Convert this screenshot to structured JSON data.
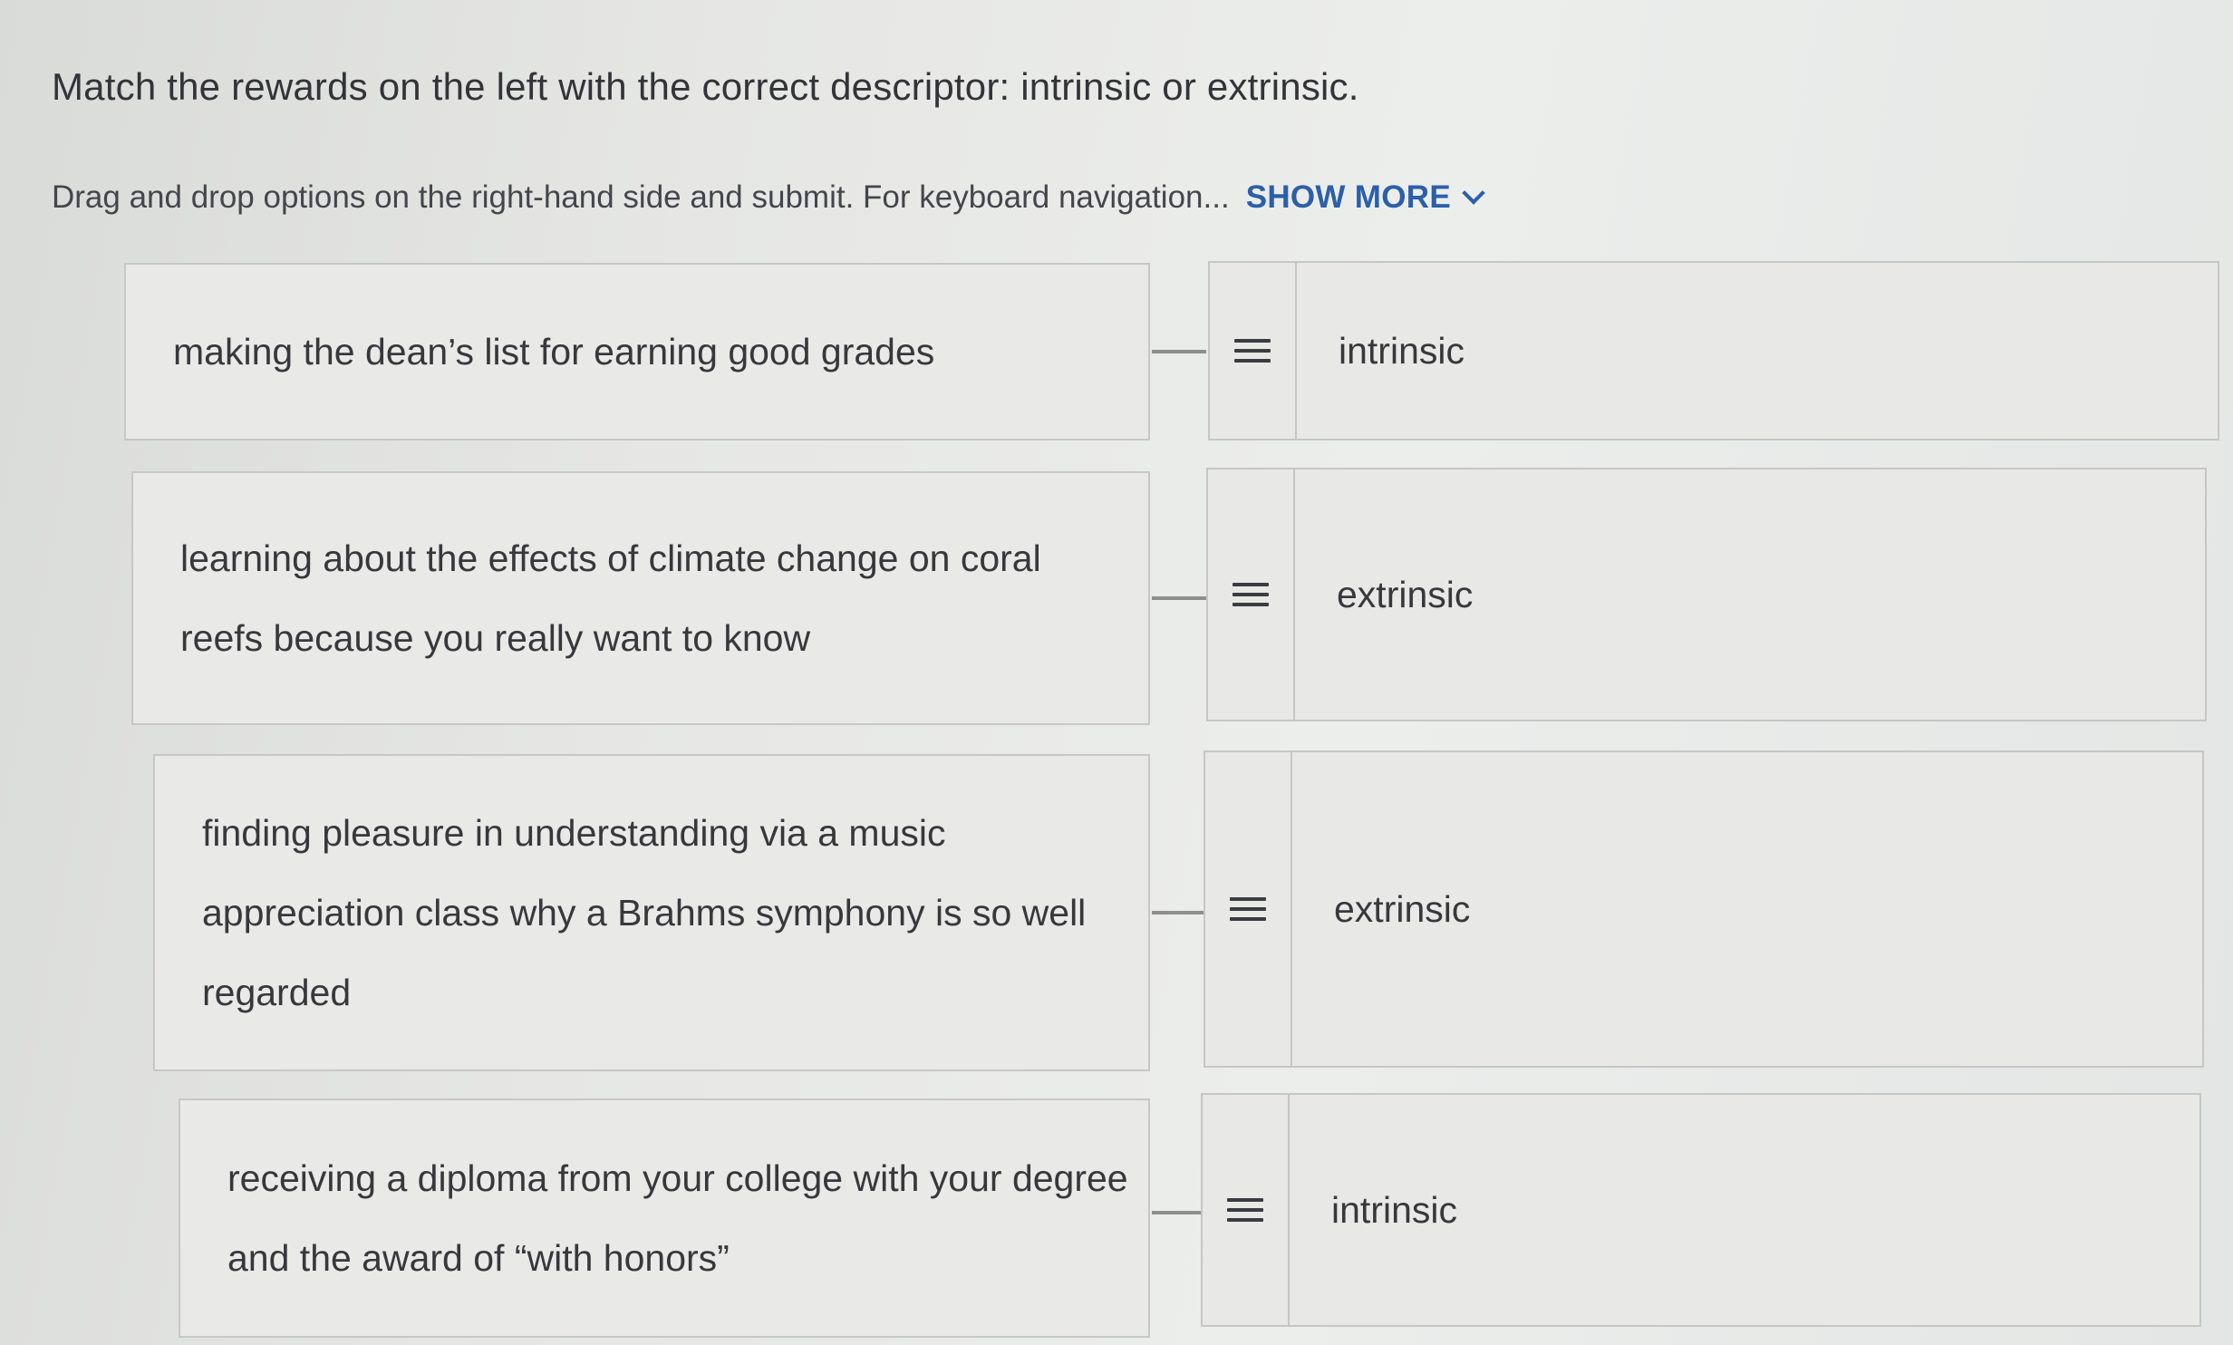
{
  "question": {
    "text": "Match the rewards on the left with the correct descriptor: intrinsic or extrinsic."
  },
  "instructions": {
    "text": "Drag and drop options on the right-hand side and submit. For keyboard navigation...",
    "show_more_label": "SHOW MORE",
    "show_more_icon": "chevron-down-icon"
  },
  "pairs": [
    {
      "prompt_lines": [
        "making the dean’s list for earning good grades"
      ],
      "answer": "intrinsic",
      "handle_icon": "drag-handle-icon"
    },
    {
      "prompt_lines": [
        "learning about the effects of climate change on coral",
        "reefs because you really want to know"
      ],
      "answer": "extrinsic",
      "handle_icon": "drag-handle-icon"
    },
    {
      "prompt_lines": [
        "finding pleasure in understanding via a music",
        "appreciation class why a Brahms symphony is so well",
        "regarded"
      ],
      "answer": "extrinsic",
      "handle_icon": "drag-handle-icon"
    },
    {
      "prompt_lines": [
        "receiving a diploma from your college with your degree",
        "and the award of “with honors”"
      ],
      "answer": "intrinsic",
      "handle_icon": "drag-handle-icon"
    }
  ]
}
